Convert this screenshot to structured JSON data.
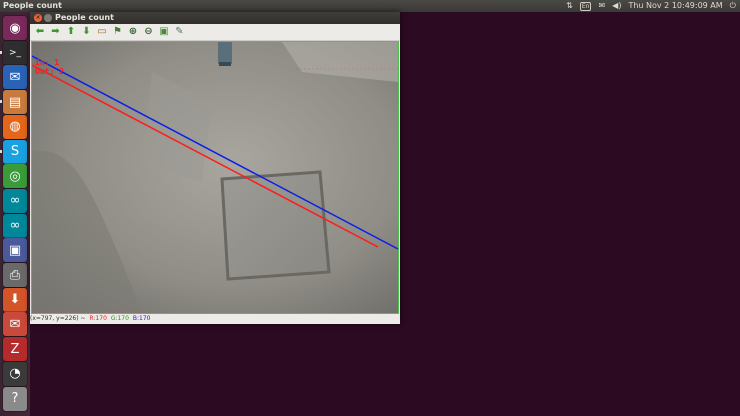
{
  "topbar": {
    "app_title": "People count",
    "keyboard_layout": "En",
    "datetime": "Thu Nov  2 10:49:09 AM",
    "icons": [
      "network-icon",
      "keyboard-icon",
      "mail-icon",
      "volume-icon",
      "power-icon"
    ]
  },
  "launcher": {
    "items": [
      {
        "name": "dash-icon",
        "glyph": "◉",
        "color": "#7a2a5a"
      },
      {
        "name": "terminal-icon",
        "glyph": ">_",
        "color": "#2e2e2e"
      },
      {
        "name": "thunderbird-icon",
        "glyph": "✉",
        "color": "#2a63b5"
      },
      {
        "name": "files-icon",
        "glyph": "▤",
        "color": "#c97b3e"
      },
      {
        "name": "firefox-icon",
        "glyph": "◍",
        "color": "#e4661b"
      },
      {
        "name": "skype-icon",
        "glyph": "S",
        "color": "#1aa1e1"
      },
      {
        "name": "chrome-icon",
        "glyph": "◎",
        "color": "#3a9b3a"
      },
      {
        "name": "arduino-icon",
        "glyph": "∞",
        "color": "#00879a"
      },
      {
        "name": "arduino-2-icon",
        "glyph": "∞",
        "color": "#00879a"
      },
      {
        "name": "remote-desktop-icon",
        "glyph": "▣",
        "color": "#4a5a9a"
      },
      {
        "name": "printer-icon",
        "glyph": "⎙",
        "color": "#6a6a6a"
      },
      {
        "name": "install-icon",
        "glyph": "⬇",
        "color": "#d4542a"
      },
      {
        "name": "mail-app-icon",
        "glyph": "✉",
        "color": "#c94a3a"
      },
      {
        "name": "filezilla-icon",
        "glyph": "Z",
        "color": "#b52a2a"
      },
      {
        "name": "game-icon",
        "glyph": "◔",
        "color": "#3a3a3a"
      },
      {
        "name": "help-icon",
        "glyph": "?",
        "color": "#8a8a8a"
      }
    ]
  },
  "window": {
    "title": "People count",
    "toolbar": [
      {
        "name": "pan-left-icon",
        "glyph": "⬅",
        "color": "#3c9a2a"
      },
      {
        "name": "pan-right-icon",
        "glyph": "➡",
        "color": "#3c9a2a"
      },
      {
        "name": "pan-up-icon",
        "glyph": "⬆",
        "color": "#3c9a2a"
      },
      {
        "name": "pan-down-icon",
        "glyph": "⬇",
        "color": "#3c9a2a"
      },
      {
        "name": "zoom-fit-icon",
        "glyph": "▭",
        "color": "#9a6a2a"
      },
      {
        "name": "zoom-100-icon",
        "glyph": "⚑",
        "color": "#4a7a3a"
      },
      {
        "name": "zoom-in-icon",
        "glyph": "⊕",
        "color": "#3a6a3a"
      },
      {
        "name": "zoom-out-icon",
        "glyph": "⊖",
        "color": "#3a6a3a"
      },
      {
        "name": "save-image-icon",
        "glyph": "▣",
        "color": "#4a8a3a"
      },
      {
        "name": "properties-icon",
        "glyph": "✎",
        "color": "#5a7a5a"
      }
    ],
    "overlay": {
      "in_label": "In: 1",
      "out_label": "Out: 2",
      "colors": {
        "blue_line": "#0b1fe8",
        "red_line": "#ff1b1b",
        "frame_border": "#4ec24e"
      }
    },
    "status": {
      "coords": "(x=797, y=226) ~",
      "r": "R:170",
      "g": "G:170",
      "b": "B:170",
      "r_color": "#e02020",
      "g_color": "#20a020",
      "b_color": "#2020e0"
    }
  }
}
